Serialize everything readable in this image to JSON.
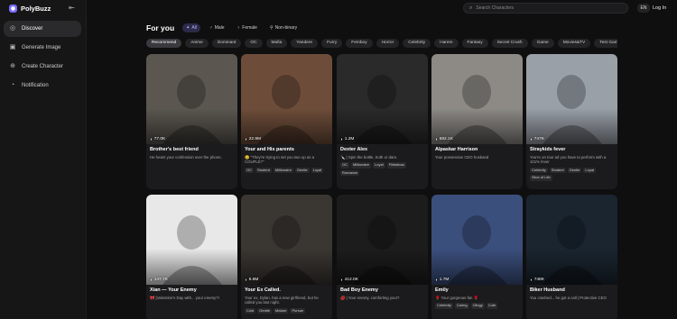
{
  "app": {
    "name": "PolyBuzz",
    "accent": "#7b6cff"
  },
  "sidebar": {
    "items": [
      {
        "label": "Discover",
        "icon": "compass-icon",
        "active": true
      },
      {
        "label": "Generate Image",
        "icon": "image-icon"
      },
      {
        "label": "Create Character",
        "icon": "user-plus-icon"
      },
      {
        "label": "Notification",
        "icon": "bell-icon"
      }
    ]
  },
  "topbar": {
    "search_placeholder": "Search Characters",
    "lang": "EN",
    "login": "Log In"
  },
  "header": {
    "title": "For you",
    "gender_tabs": [
      {
        "label": "All",
        "icon": "sparkle-icon",
        "active": true
      },
      {
        "label": "Male",
        "icon": "male-icon"
      },
      {
        "label": "Female",
        "icon": "female-icon"
      },
      {
        "label": "Non-binary",
        "icon": "nonbinary-icon"
      }
    ]
  },
  "categories": [
    "Recommend",
    "Anime",
    "Dominant",
    "OC",
    "Mafia",
    "Yandere",
    "Furry",
    "Femboy",
    "Horror",
    "Celebrity",
    "Harem",
    "Fantasy",
    "Secret Crush",
    "Game",
    "Movies&TV",
    "Test Game"
  ],
  "cards": [
    {
      "title": "Brother's best friend",
      "count": "77.0K",
      "desc": "He hears your confession over the phone.",
      "tags": [],
      "bg": "#5b5750"
    },
    {
      "title": "Your and His parents",
      "count": "22.9M",
      "desc": "😢 \"They're trying to set you two up as a COUPLE?\"",
      "tags": [
        "OC",
        "Student",
        "Millionaire",
        "Gentle",
        "Loyal"
      ],
      "bg": "#6d4d3a"
    },
    {
      "title": "Dexter Alex",
      "count": "1.2M",
      "desc": "🔪 | Spin the bottle, truth or dare.",
      "tags": [
        "OC",
        "Millionaire",
        "Loyal",
        "Flirtatious",
        "Romance"
      ],
      "bg": "#2a2a2a"
    },
    {
      "title": "Alpaskar Harrison",
      "count": "582.1K",
      "desc": "Your possessive CEO husband",
      "tags": [],
      "bg": "#8d8a85"
    },
    {
      "title": "Straykids fever",
      "count": "747K",
      "desc": "You're on tour ad you have to perform with a 101% fever",
      "tags": [
        "Celebrity",
        "Student",
        "Gentle",
        "Loyal",
        "Slice of Life"
      ],
      "bg": "#9aa0a8"
    },
    {
      "title": "Xian — Your Enemy",
      "count": "147.7K",
      "desc": "🎀 [Valentine's Day with... your enemy?!",
      "tags": [],
      "bg": "#e8e8e8"
    },
    {
      "title": "Your Ex Called.",
      "count": "6.6M",
      "desc": "Your ex, Dylan, has a new girlfriend, but he called you last night.",
      "tags": [
        "Cold",
        "Gentle",
        "Mature",
        "Pursue"
      ],
      "bg": "#3a3632"
    },
    {
      "title": "Bad Boy Enemy",
      "count": "412.0K",
      "desc": "💋 | Your enemy, comforting you!?",
      "tags": [],
      "bg": "#1c1c1c"
    },
    {
      "title": "Emily",
      "count": "1.7M",
      "desc": "🌹 Your gorgeous fan 🌹",
      "tags": [
        "Celebrity",
        "Caring",
        "Clingy",
        "Cute"
      ],
      "bg": "#3b4f7d"
    },
    {
      "title": "Biker Husband",
      "count": "748K",
      "desc": "You crashed... he got a call | Protective CEO",
      "tags": [],
      "bg": "#1a2530"
    }
  ]
}
